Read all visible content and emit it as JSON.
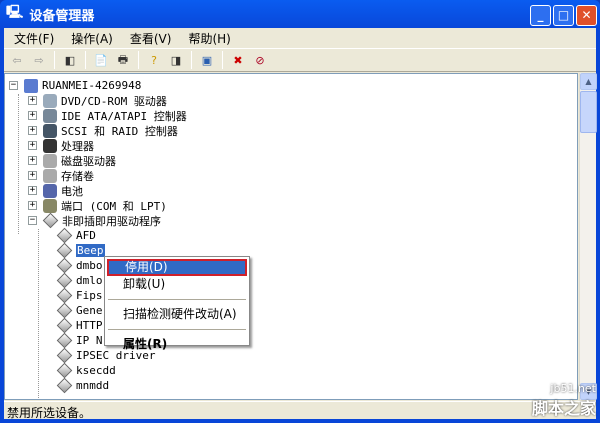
{
  "window": {
    "title": "设备管理器",
    "min": "_",
    "max": "□",
    "close": "✕"
  },
  "menubar": [
    "文件(F)",
    "操作(A)",
    "查看(V)",
    "帮助(H)"
  ],
  "toolbar": {
    "icons": [
      "back-icon",
      "forward-icon",
      "show-hide-tree-icon",
      "properties-icon",
      "print-icon",
      "help-icon",
      "console-icon",
      "scan-hardware-icon",
      "uninstall-icon",
      "disable-icon"
    ]
  },
  "tree": {
    "root": "RUANMEI-4269948",
    "categories": [
      "DVD/CD-ROM 驱动器",
      "IDE ATA/ATAPI 控制器",
      "SCSI 和 RAID 控制器",
      "处理器",
      "磁盘驱动器",
      "存储卷",
      "电池",
      "端口 (COM 和 LPT)",
      "非即插即用驱动程序"
    ],
    "children": [
      "AFD",
      "Beep",
      "dmbo",
      "dmlo",
      "Fips",
      "Gene",
      "HTTP",
      "IP N",
      "IPSEC driver",
      "ksecdd",
      "mnmdd"
    ],
    "selected": "Beep"
  },
  "context_menu": {
    "items": [
      "停用(D)",
      "卸载(U)",
      "扫描检测硬件改动(A)",
      "属性(R)"
    ],
    "highlighted": "停用(D)"
  },
  "status": "禁用所选设备。",
  "watermark": {
    "site": "jb51.net",
    "name": "脚本之家"
  }
}
